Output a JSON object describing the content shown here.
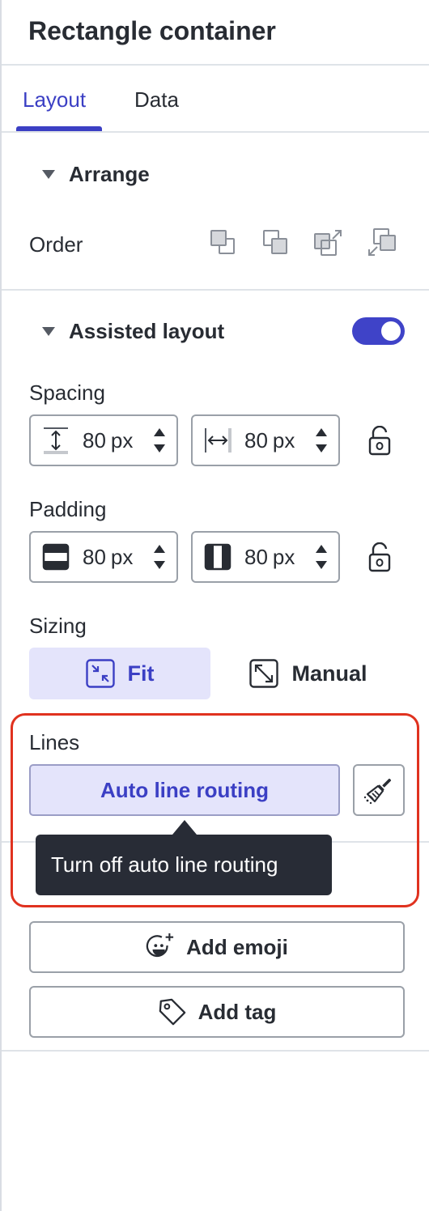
{
  "header": {
    "title": "Rectangle container"
  },
  "tabs": [
    {
      "label": "Layout",
      "active": true
    },
    {
      "label": "Data",
      "active": false
    }
  ],
  "arrange": {
    "heading": "Arrange",
    "order_label": "Order",
    "order_icons": [
      "bring-to-front-icon",
      "send-to-back-icon",
      "bring-forward-icon",
      "send-backward-icon"
    ]
  },
  "assisted_layout": {
    "heading": "Assisted layout",
    "enabled": true,
    "spacing": {
      "label": "Spacing",
      "vertical": {
        "value": "80",
        "unit": "px"
      },
      "horizontal": {
        "value": "80",
        "unit": "px"
      },
      "locked": false
    },
    "padding": {
      "label": "Padding",
      "vertical": {
        "value": "80",
        "unit": "px"
      },
      "horizontal": {
        "value": "80",
        "unit": "px"
      },
      "locked": false
    },
    "sizing": {
      "label": "Sizing",
      "fit_label": "Fit",
      "manual_label": "Manual",
      "selected": "Fit"
    },
    "lines": {
      "label": "Lines",
      "route_button_label": "Auto line routing",
      "tooltip": "Turn off auto line routing"
    }
  },
  "actions": {
    "add_emoji_label": "Add emoji",
    "add_tag_label": "Add tag"
  },
  "colors": {
    "accent": "#3b3fc4",
    "accent_bg": "#e4e4fb",
    "highlight": "#e0321f",
    "tooltip_bg": "#282c36"
  }
}
